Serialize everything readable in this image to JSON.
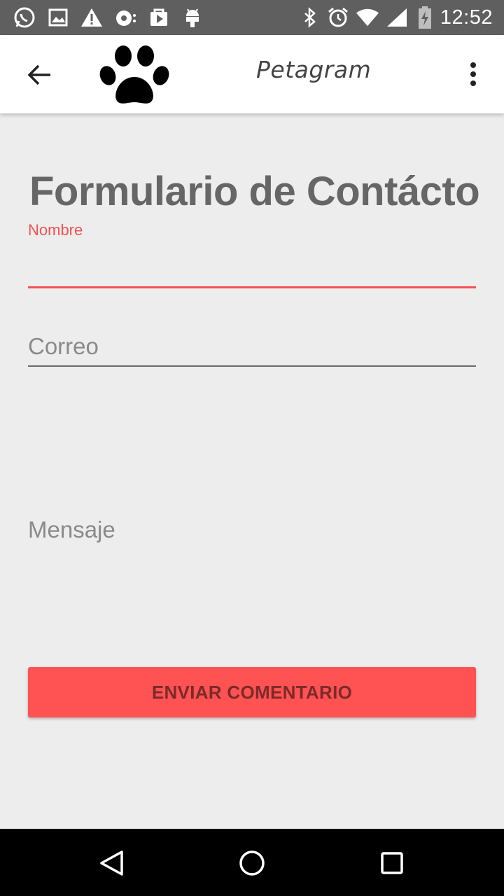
{
  "status_bar": {
    "time": "12:52",
    "icons_left": [
      "whatsapp-icon",
      "gallery-icon",
      "warning-icon",
      "media-icon",
      "play-store-icon",
      "android-icon"
    ],
    "icons_right": [
      "bluetooth-icon",
      "alarm-icon",
      "wifi-icon",
      "signal-icon",
      "battery-charging-icon"
    ]
  },
  "app_bar": {
    "title": "Petagram",
    "logo": "paw-icon"
  },
  "form": {
    "title": "Formulario de Contácto",
    "nombre_label": "Nombre",
    "nombre_value": "",
    "correo_placeholder": "Correo",
    "mensaje_placeholder": "Mensaje",
    "submit_label": "ENVIAR COMENTARIO"
  },
  "colors": {
    "accent": "#f25151",
    "button": "#ff5252",
    "background": "#ededed",
    "status_bar": "#5f5f5f"
  }
}
